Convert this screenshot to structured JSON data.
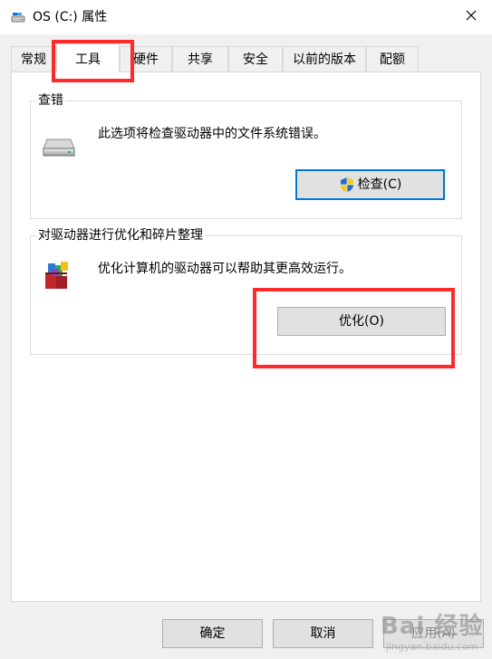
{
  "window": {
    "title": "OS (C:) 属性"
  },
  "tabs": [
    {
      "label": "常规"
    },
    {
      "label": "工具"
    },
    {
      "label": "硬件"
    },
    {
      "label": "共享"
    },
    {
      "label": "安全"
    },
    {
      "label": "以前的版本"
    },
    {
      "label": "配额"
    }
  ],
  "error_check": {
    "title": "查错",
    "description": "此选项将检查驱动器中的文件系统错误。",
    "button_label": "检查(C)"
  },
  "optimize": {
    "title": "对驱动器进行优化和碎片整理",
    "description": "优化计算机的驱动器可以帮助其更高效运行。",
    "button_label": "优化(O)"
  },
  "footer": {
    "ok_label": "确定",
    "cancel_label": "取消",
    "apply_label": "应用(A)"
  },
  "watermark": {
    "text": "Bai 经验",
    "sub": "jingyan.baidu.com"
  },
  "icons": {
    "title": "drive-icon",
    "close": "close-icon",
    "error_check": "hard-drive-icon",
    "shield": "uac-shield-icon",
    "optimize": "defrag-icon"
  },
  "colors": {
    "highlight": "#ff2a2a",
    "default_button_border": "#0078d7"
  }
}
